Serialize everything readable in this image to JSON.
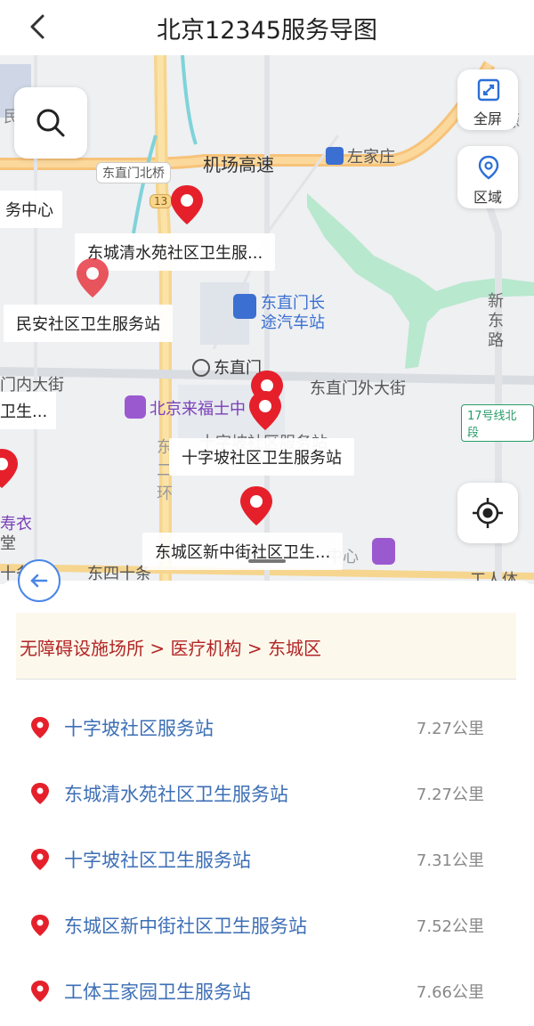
{
  "header": {
    "title": "北京12345服务导图"
  },
  "map": {
    "labels": {
      "airport_express": "机场高速",
      "zuojiazhuang": "左家庄",
      "dongzhimen_north_bridge": "东直门北桥",
      "road_num": "13",
      "bus_station_line1": "东直门长",
      "bus_station_line2": "途汽车站",
      "xin_dong_lu": "新东路",
      "dongzhimen": "东直门",
      "dongzhimen_outer_street": "东直门外大街",
      "neidajie": "门内大街",
      "carrefour": "北京来福士中",
      "metro_line17": "17号线北段",
      "east_second_ring": "东二环",
      "dongsi_shitiao": "东四十条",
      "left_clipped1": "务中心",
      "left_clipped2": "卫生...",
      "left_clipped3": "寿衣",
      "left_clipped4": "堂",
      "left_clipped5": "十条",
      "right_clipped": "新源",
      "center_clipped": "中心",
      "gongti": "工人体",
      "mingren": "民",
      "shizipo_faded": "十字坡社区服务站"
    },
    "poi_cards": {
      "qingshuiyuan": "东城清水苑社区卫生服...",
      "minan": "民安社区卫生服务站",
      "shizipo_health": "十字坡社区卫生服务站",
      "xinzhongjie": "东城区新中街社区卫生..."
    },
    "controls": {
      "fullscreen": "全屏",
      "region": "区域"
    }
  },
  "panel": {
    "breadcrumb": "无障碍设施场所 > 医疗机构 > 东城区",
    "results": [
      {
        "name": "十字坡社区服务站",
        "distance": "7.27公里"
      },
      {
        "name": "东城清水苑社区卫生服务站",
        "distance": "7.27公里"
      },
      {
        "name": "十字坡社区卫生服务站",
        "distance": "7.31公里"
      },
      {
        "name": "东城区新中街社区卫生服务站",
        "distance": "7.52公里"
      },
      {
        "name": "工体王家园卫生服务站",
        "distance": "7.66公里"
      }
    ]
  },
  "colors": {
    "pin": "#e5202b",
    "link": "#3d6fb6",
    "crumb_text": "#b22525",
    "crumb_bg": "#fdf8ec"
  },
  "icons": [
    "back-chevron-icon",
    "search-icon",
    "fullscreen-icon",
    "region-pin-icon",
    "locate-icon",
    "circle-back-icon",
    "map-pin-icon"
  ]
}
